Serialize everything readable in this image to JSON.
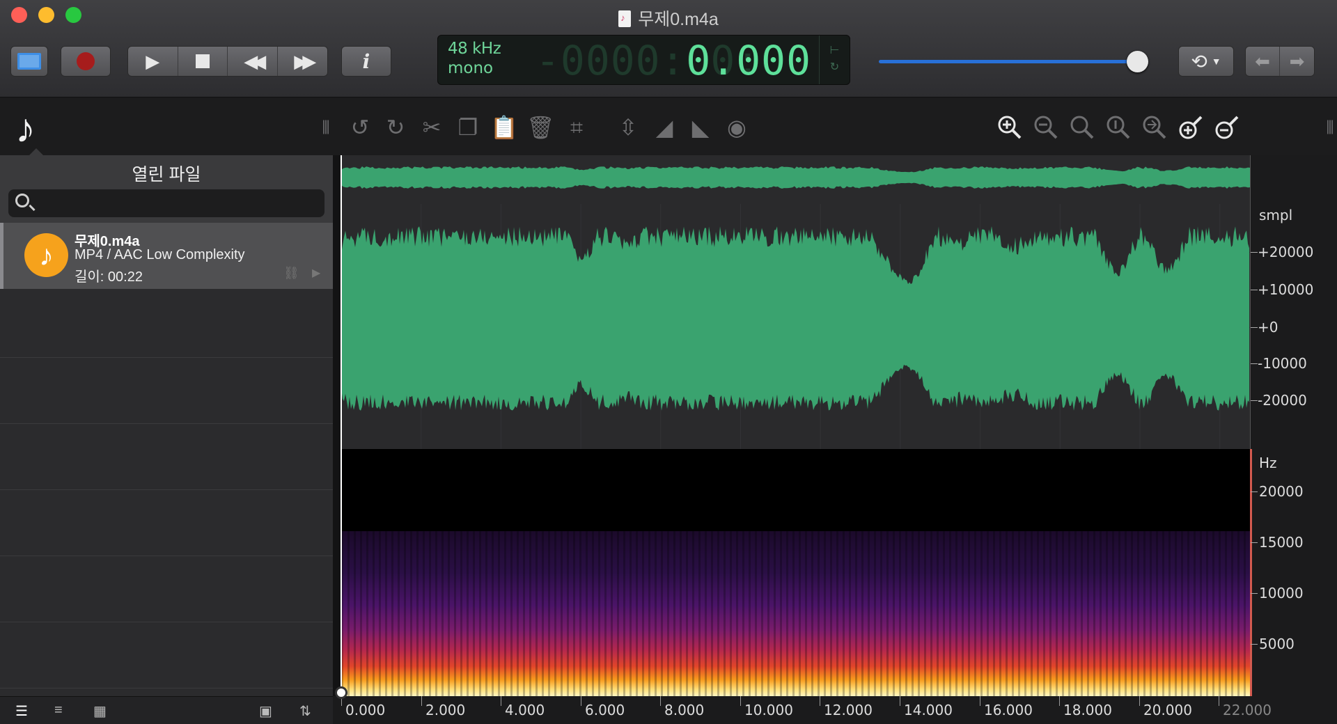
{
  "window": {
    "title": "무제0.m4a",
    "traffic_colors": [
      "#fe5f57",
      "#febc2e",
      "#28c840"
    ]
  },
  "toolbar": {
    "view_toggle_icon": "view-toggle-icon",
    "record_icon": "record-icon",
    "play_icon": "play-icon",
    "stop_icon": "stop-icon",
    "rewind_icon": "rewind-icon",
    "fastforward_icon": "fastforward-icon",
    "info_label": "i",
    "history_icon": "history-icon",
    "back_icon": "arrow-left-icon",
    "forward_icon": "arrow-right-icon"
  },
  "lcd": {
    "sample_rate": "48 kHz",
    "channels": "mono",
    "ghost_digits": "-0000:00:0",
    "time": "0.000",
    "accent": "#5ee09a"
  },
  "volume": {
    "level": 0.94,
    "color": "#2870d8"
  },
  "sidebar": {
    "title": "열린 파일",
    "search_placeholder": "",
    "files": [
      {
        "name": "무제0.m4a",
        "format": "MP4 / AAC Low Complexity",
        "length": "길이: 00:22"
      }
    ]
  },
  "waveform": {
    "color": "#3aa36f",
    "y_unit": "smpl",
    "y_labels": [
      "+20000",
      "+10000",
      "+0",
      "-10000",
      "-20000"
    ]
  },
  "spectrogram": {
    "y_unit": "Hz",
    "y_labels": [
      "20000",
      "15000",
      "10000",
      "5000"
    ]
  },
  "timeline": {
    "x_labels": [
      "0.000",
      "2.000",
      "4.000",
      "6.000",
      "8.000",
      "10.000",
      "12.000",
      "14.000",
      "16.000",
      "18.000",
      "20.000",
      "22.000"
    ]
  }
}
